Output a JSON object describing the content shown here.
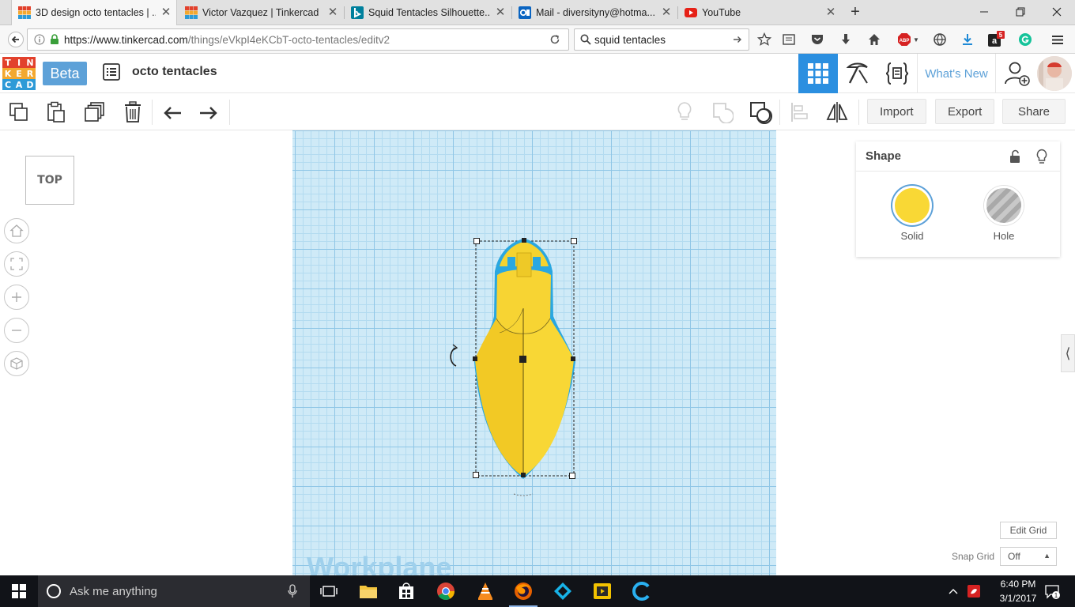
{
  "browser": {
    "tabs": [
      {
        "title": "3D design octo tentacles | ...",
        "icon": "tinkercad-favicon-icon",
        "active": true
      },
      {
        "title": "Victor Vazquez | Tinkercad",
        "icon": "tinkercad-favicon-icon",
        "active": false
      },
      {
        "title": "Squid Tentacles Silhouette...",
        "icon": "bing-favicon-icon",
        "active": false
      },
      {
        "title": "Mail - diversityny@hotma...",
        "icon": "outlook-favicon-icon",
        "active": false
      },
      {
        "title": "YouTube",
        "icon": "youtube-favicon-icon",
        "active": false
      }
    ],
    "url_host": "https://www.tinkercad.com",
    "url_path": "/things/eVkpI4eKCbT-octo-tentacles/editv2",
    "search_value": "squid tentacles",
    "abp_label": "ABP",
    "notification_badge": "5"
  },
  "app": {
    "logo_letters": [
      "T",
      "I",
      "N",
      "K",
      "E",
      "R",
      "C",
      "A",
      "D"
    ],
    "logo_colors": [
      "#e2412c",
      "#e2412c",
      "#e2412c",
      "#f3a82f",
      "#f3a82f",
      "#f3a82f",
      "#2d9ad7",
      "#2d9ad7",
      "#2d9ad7"
    ],
    "beta_label": "Beta",
    "design_name": "octo tentacles",
    "whats_new_label": "What's New",
    "accent_color": "#2b8fe0"
  },
  "toolbar": {
    "import_label": "Import",
    "export_label": "Export",
    "share_label": "Share"
  },
  "workspace": {
    "viewcube_label": "TOP",
    "workplane_label": "Workplane"
  },
  "inspector": {
    "title": "Shape",
    "solid_label": "Solid",
    "hole_label": "Hole",
    "solid_color": "#f9d835"
  },
  "grid": {
    "edit_grid_label": "Edit Grid",
    "snap_grid_label": "Snap Grid",
    "snap_grid_value": "Off"
  },
  "taskbar": {
    "search_placeholder": "Ask me anything",
    "time": "6:40 PM",
    "date": "3/1/2017",
    "notification_count": "1"
  }
}
